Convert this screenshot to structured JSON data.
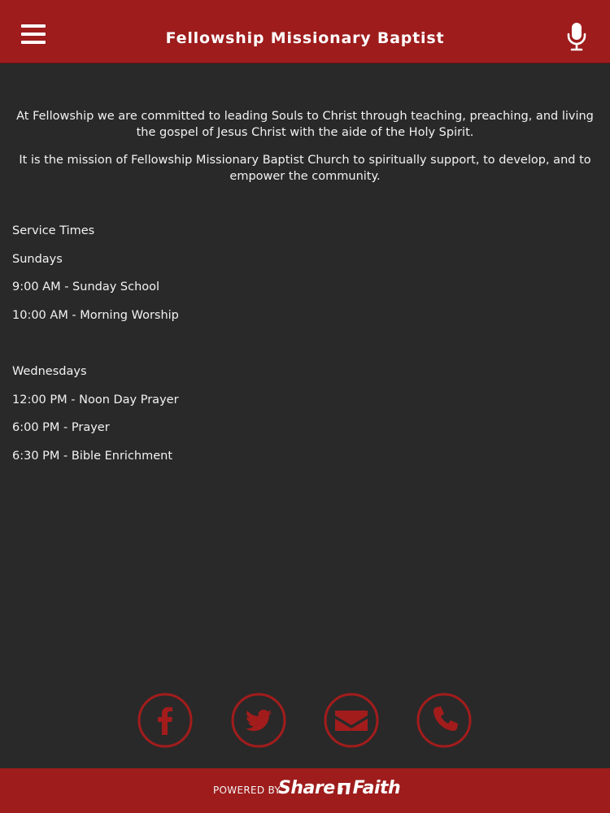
{
  "header": {
    "title": "Fellowship Missionary Baptist",
    "menu_icon": "hamburger-menu-icon",
    "mic_icon": "microphone-icon"
  },
  "mission": {
    "paragraph1": "At Fellowship we are committed to leading Souls to Christ through teaching,  preaching, and living the gospel of Jesus Christ with the aide of the Holy Spirit.",
    "paragraph2": "It is the mission of Fellowship Missionary Baptist Church to spiritually support, to develop, and to empower the community."
  },
  "services": {
    "heading": "Service Times",
    "sundays_label": "Sundays",
    "sunday_items": [
      "9:00 AM - Sunday School",
      "10:00 AM - Morning Worship"
    ],
    "wednesdays_label": "Wednesdays",
    "wednesday_items": [
      "12:00 PM - Noon Day Prayer",
      "6:00 PM - Prayer",
      "6:30 PM - Bible Enrichment"
    ]
  },
  "social": {
    "icons": [
      "facebook-icon",
      "twitter-icon",
      "email-icon",
      "phone-icon"
    ]
  },
  "footer": {
    "powered_by": "POWERED BY",
    "brand_left": "Share",
    "brand_right": "Faith"
  },
  "colors": {
    "header_bg": "#9e1c1c",
    "page_bg": "#292929",
    "accent_red": "#a31c1c",
    "text": "#f2f2f2"
  }
}
